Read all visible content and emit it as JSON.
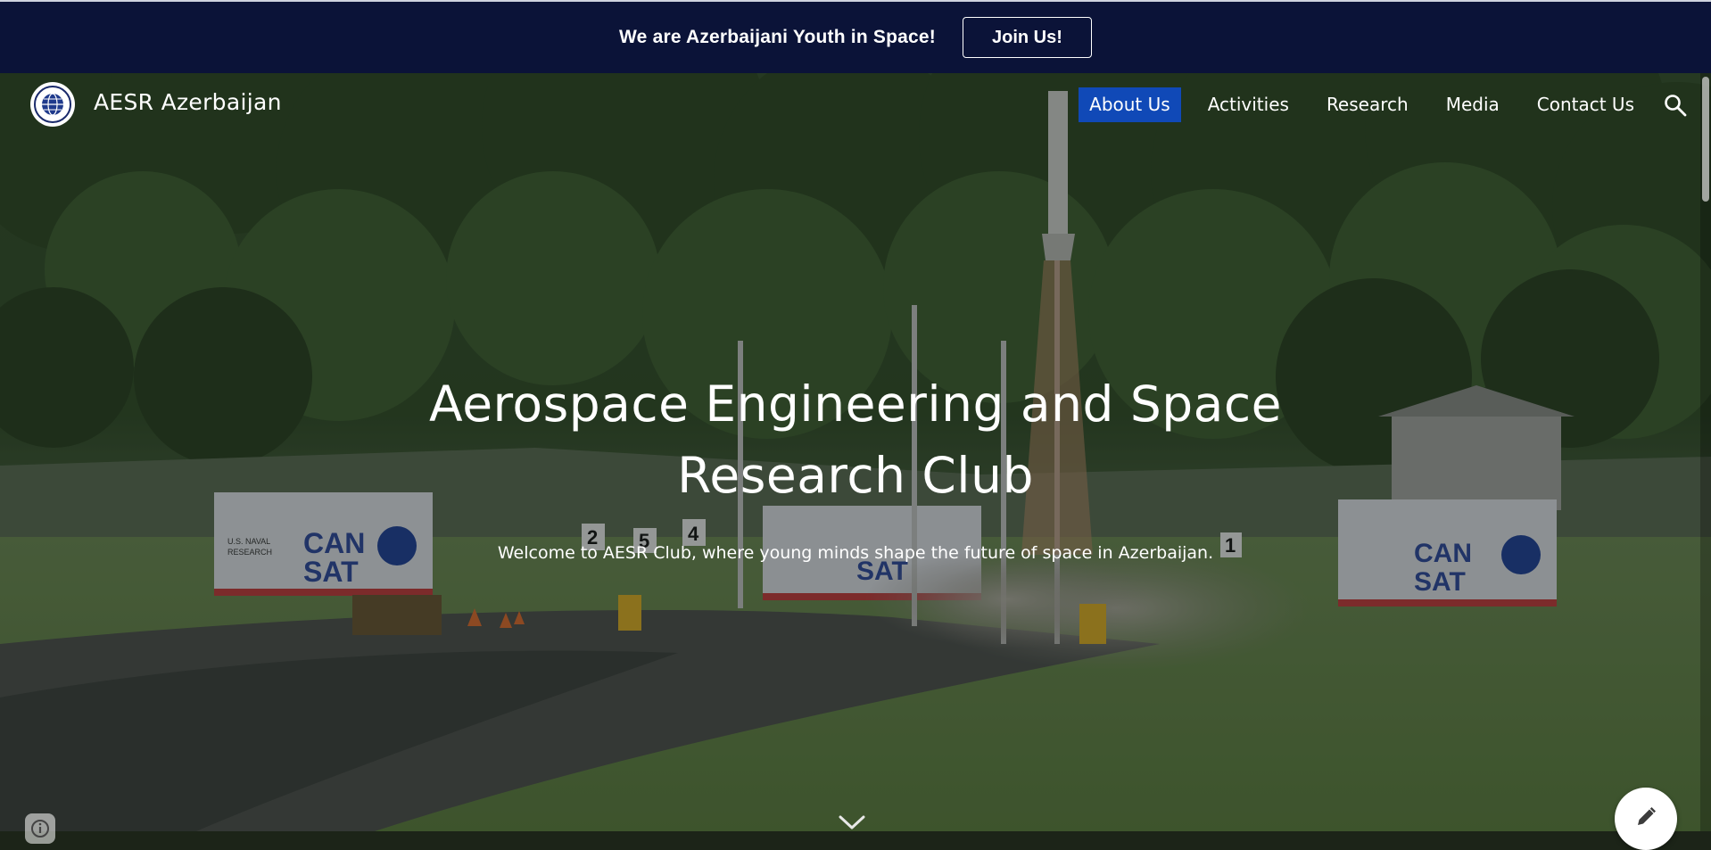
{
  "banner": {
    "text": "We are Azerbaijani Youth in Space!",
    "button_label": "Join Us!",
    "background_color": "#0b1338"
  },
  "header": {
    "site_title": "AESR Azerbaijan",
    "logo_icon": "globe-logo-icon",
    "nav": [
      {
        "label": "About Us",
        "active": true
      },
      {
        "label": "Activities",
        "active": false
      },
      {
        "label": "Research",
        "active": false
      },
      {
        "label": "Media",
        "active": false
      },
      {
        "label": "Contact Us",
        "active": false
      }
    ],
    "active_color": "#1049b7",
    "search_icon": "search-icon"
  },
  "hero": {
    "title": "Aerospace Engineering and Space Research Club",
    "subtitle": "Welcome to AESR Club, where young minds shape the future of space in Azerbaijan.",
    "scroll_icon": "chevron-down-icon",
    "scene_signs": [
      "2",
      "5",
      "4",
      "1"
    ],
    "banner_signs": [
      "U.S. NAVAL RESEARCH",
      "CAN SAT"
    ]
  },
  "controls": {
    "edit_icon": "pencil-icon",
    "info_icon": "info-icon"
  }
}
